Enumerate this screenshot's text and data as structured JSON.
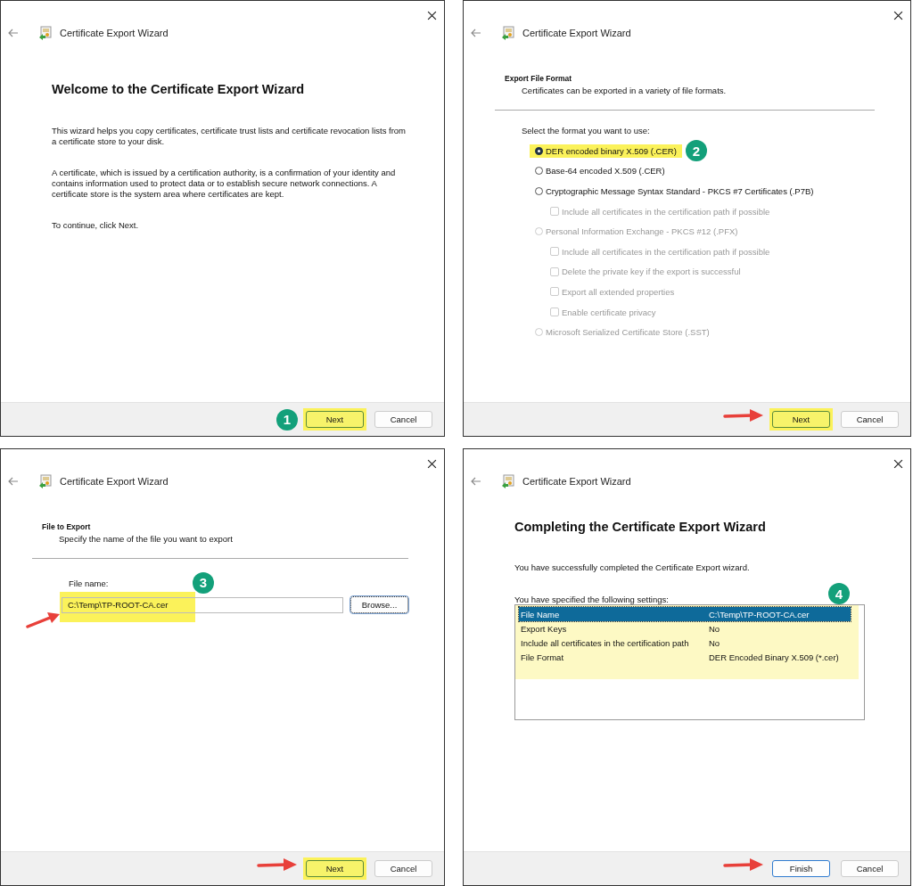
{
  "panels": [
    {
      "kind": "welcome",
      "title": "Certificate Export Wizard",
      "heading": "Welcome to the Certificate Export Wizard",
      "paragraphs": [
        "This wizard helps you copy certificates, certificate trust lists and certificate revocation lists from a certificate store to your disk.",
        "A certificate, which is issued by a certification authority, is a confirmation of your identity and contains information used to protect data or to establish secure network connections. A certificate store is the system area where certificates are kept.",
        "To continue, click Next."
      ],
      "step": "1",
      "buttons": [
        {
          "label": "Next",
          "highlighted": true,
          "pointer": false,
          "default": true
        },
        {
          "label": "Cancel",
          "highlighted": false,
          "pointer": false,
          "default": false
        }
      ]
    },
    {
      "kind": "format",
      "title": "Certificate Export Wizard",
      "section": "Export File Format",
      "subtitle": "Certificates can be exported in a variety of file formats.",
      "prompt": "Select the format you want to use:",
      "options": [
        {
          "kind": "radio",
          "label": "DER encoded binary X.509 (.CER)",
          "selected": true,
          "disabled": false,
          "highlighted": true,
          "step": "2"
        },
        {
          "kind": "radio",
          "label": "Base-64 encoded X.509 (.CER)",
          "selected": false,
          "disabled": false,
          "highlighted": false
        },
        {
          "kind": "radio",
          "label": "Cryptographic Message Syntax Standard - PKCS #7 Certificates (.P7B)",
          "selected": false,
          "disabled": false,
          "highlighted": false
        },
        {
          "kind": "checkbox",
          "label": "Include all certificates in the certification path if possible",
          "checked": false,
          "disabled": true
        },
        {
          "kind": "radio",
          "label": "Personal Information Exchange - PKCS #12 (.PFX)",
          "selected": false,
          "disabled": true,
          "highlighted": false
        },
        {
          "kind": "checkbox",
          "label": "Include all certificates in the certification path if possible",
          "checked": false,
          "disabled": true
        },
        {
          "kind": "checkbox",
          "label": "Delete the private key if the export is successful",
          "checked": false,
          "disabled": true
        },
        {
          "kind": "checkbox",
          "label": "Export all extended properties",
          "checked": false,
          "disabled": true
        },
        {
          "kind": "checkbox",
          "label": "Enable certificate privacy",
          "checked": false,
          "disabled": true
        },
        {
          "kind": "radio",
          "label": "Microsoft Serialized Certificate Store (.SST)",
          "selected": false,
          "disabled": true,
          "highlighted": false
        }
      ],
      "buttons": [
        {
          "label": "Next",
          "highlighted": true,
          "pointer": true,
          "default": true
        },
        {
          "label": "Cancel",
          "highlighted": false,
          "pointer": false,
          "default": false
        }
      ]
    },
    {
      "kind": "file",
      "title": "Certificate Export Wizard",
      "section": "File to Export",
      "subtitle": "Specify the name of the file you want to export",
      "field": {
        "label": "File name:",
        "value": "C:\\Temp\\TP-ROOT-CA.cer",
        "highlighted": true,
        "pointer": true,
        "step": "3"
      },
      "browse": "Browse...",
      "buttons": [
        {
          "label": "Next",
          "highlighted": true,
          "pointer": true,
          "default": true
        },
        {
          "label": "Cancel",
          "highlighted": false,
          "pointer": false,
          "default": false
        }
      ]
    },
    {
      "kind": "complete",
      "title": "Certificate Export Wizard",
      "heading": "Completing the Certificate Export Wizard",
      "text": "You have successfully completed the Certificate Export wizard.",
      "settings_label": "You have specified the following settings:",
      "step": "4",
      "highlighted": true,
      "settings": [
        {
          "name": "File Name",
          "value": "C:\\Temp\\TP-ROOT-CA.cer",
          "selected": true
        },
        {
          "name": "Export Keys",
          "value": "No",
          "selected": false
        },
        {
          "name": "Include all certificates in the certification path",
          "value": "No",
          "selected": false
        },
        {
          "name": "File Format",
          "value": "DER Encoded Binary X.509 (*.cer)",
          "selected": false
        }
      ],
      "buttons": [
        {
          "label": "Finish",
          "highlighted": false,
          "pointer": true,
          "default": true
        },
        {
          "label": "Cancel",
          "highlighted": false,
          "pointer": false,
          "default": false
        }
      ]
    }
  ]
}
